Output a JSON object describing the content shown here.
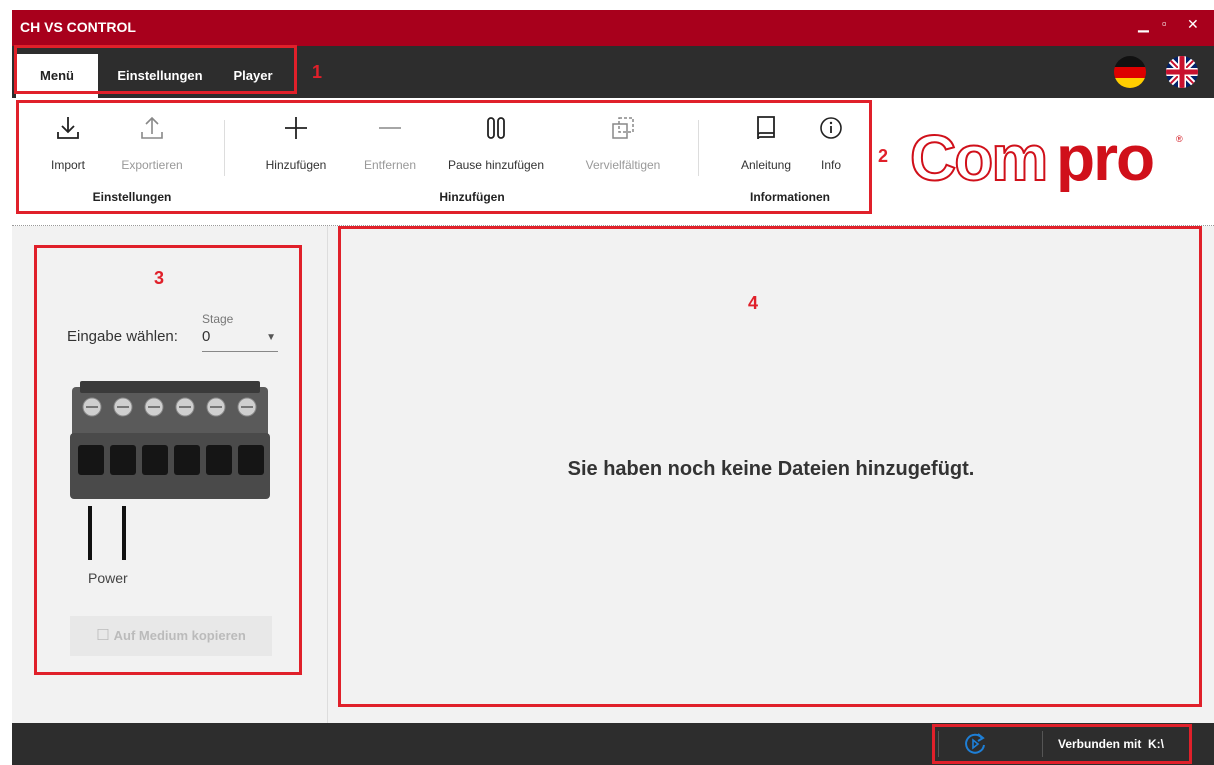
{
  "window": {
    "title": "CH VS CONTROL"
  },
  "menu": {
    "tabs": [
      {
        "label": "Menü"
      },
      {
        "label": "Einstellungen"
      },
      {
        "label": "Player"
      }
    ]
  },
  "ribbon": {
    "buttons": [
      {
        "label": "Import",
        "icon": "download-icon"
      },
      {
        "label": "Exportieren",
        "icon": "upload-icon"
      },
      {
        "label": "Hinzufügen",
        "icon": "plus-icon"
      },
      {
        "label": "Entfernen",
        "icon": "minus-icon"
      },
      {
        "label": "Pause hinzufügen",
        "icon": "pause-icon"
      },
      {
        "label": "Vervielfältigen",
        "icon": "duplicate-icon"
      },
      {
        "label": "Anleitung",
        "icon": "book-icon"
      },
      {
        "label": "Info",
        "icon": "info-icon"
      }
    ],
    "groups": [
      {
        "label": "Einstellungen"
      },
      {
        "label": "Hinzufügen"
      },
      {
        "label": "Informationen"
      }
    ]
  },
  "logo": {
    "text": "Compro"
  },
  "annotations": {
    "one": "1",
    "two": "2",
    "three": "3",
    "four": "4"
  },
  "left_panel": {
    "stage_label": "Stage",
    "select_label": "Eingabe wählen:",
    "select_value": "0",
    "power_label": "Power",
    "copy_button": "Auf Medium kopieren"
  },
  "main_panel": {
    "empty_message": "Sie haben noch keine Dateien hinzugefügt."
  },
  "status": {
    "connection": "Verbunden mit  K:\\"
  },
  "colors": {
    "accent": "#a8001c",
    "annotation": "#e0202a",
    "dark_bar": "#2d2d2d",
    "link_blue": "#1e7fd6"
  }
}
